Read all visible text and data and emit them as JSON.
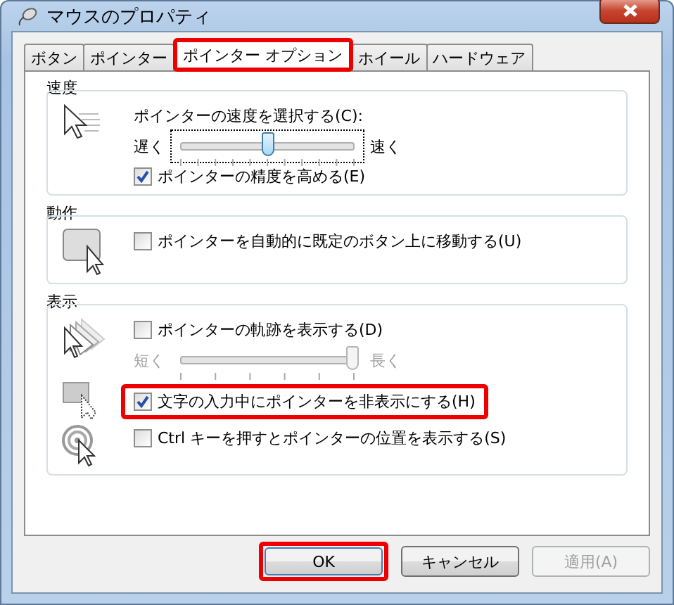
{
  "window": {
    "title": "マウスのプロパティ"
  },
  "tabs": [
    {
      "label": "ボタン",
      "selected": false,
      "highlighted": false
    },
    {
      "label": "ポインター",
      "selected": false,
      "highlighted": false
    },
    {
      "label": "ポインター オプション",
      "selected": true,
      "highlighted": true
    },
    {
      "label": "ホイール",
      "selected": false,
      "highlighted": false
    },
    {
      "label": "ハードウェア",
      "selected": false,
      "highlighted": false
    }
  ],
  "sections": [
    {
      "title": "速度",
      "rows": [
        {
          "controls": [
            {
              "kind": "caption",
              "label": "ポインターの速度を選択する(C):"
            },
            {
              "kind": "slider",
              "left": "遅く",
              "right": "速く",
              "level": 0.51,
              "disabled": false,
              "focused": true
            },
            {
              "kind": "checkbox",
              "label": "ポインターの精度を高める(E)",
              "checked": true,
              "highlighted": false
            }
          ]
        }
      ]
    },
    {
      "title": "動作",
      "rows": [
        {
          "controls": [
            {
              "kind": "checkbox",
              "label": "ポインターを自動的に既定のボタン上に移動する(U)",
              "checked": false,
              "highlighted": false
            }
          ]
        }
      ]
    },
    {
      "title": "表示",
      "rows": [
        {
          "controls": [
            {
              "kind": "checkbox",
              "label": "ポインターの軌跡を表示する(D)",
              "checked": false,
              "highlighted": false
            },
            {
              "kind": "slider",
              "left": "短く",
              "right": "長く",
              "level": 1,
              "disabled": true,
              "focused": false
            }
          ]
        },
        {
          "controls": [
            {
              "kind": "checkbox",
              "label": "文字の入力中にポインターを非表示にする(H)",
              "checked": true,
              "highlighted": true
            }
          ]
        },
        {
          "controls": [
            {
              "kind": "checkbox",
              "label": "Ctrl キーを押すとポインターの位置を表示する(S)",
              "checked": false,
              "highlighted": false
            }
          ]
        }
      ]
    }
  ],
  "buttons": [
    {
      "label": "OK",
      "disabled": false,
      "highlighted": true
    },
    {
      "label": "キャンセル",
      "disabled": false,
      "highlighted": false
    },
    {
      "label": "適用(A)",
      "disabled": true,
      "highlighted": false
    }
  ]
}
